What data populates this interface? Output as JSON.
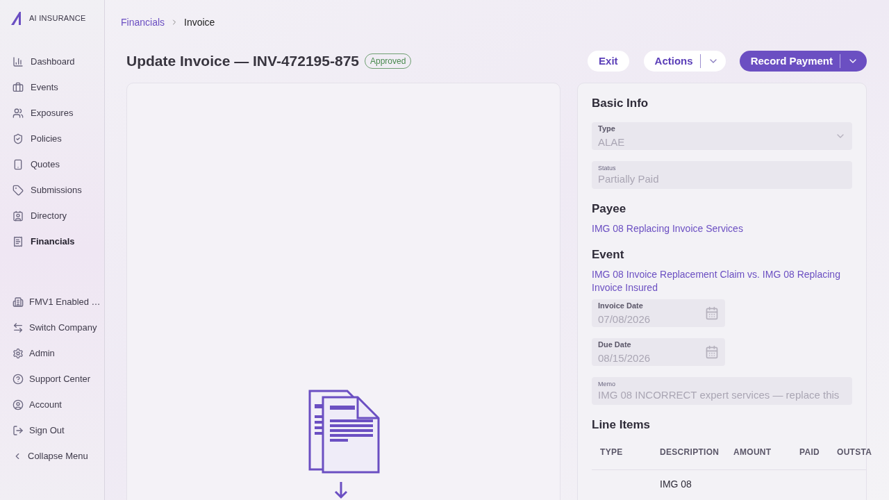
{
  "brand": {
    "name": "AI INSURANCE"
  },
  "nav": [
    {
      "label": "Dashboard",
      "selected": false
    },
    {
      "label": "Events",
      "selected": false
    },
    {
      "label": "Exposures",
      "selected": false
    },
    {
      "label": "Policies",
      "selected": false
    },
    {
      "label": "Quotes",
      "selected": false
    },
    {
      "label": "Submissions",
      "selected": false
    },
    {
      "label": "Directory",
      "selected": false
    },
    {
      "label": "Financials",
      "selected": true
    }
  ],
  "nav_bottom": [
    {
      "label": "FMV1 Enabled …"
    },
    {
      "label": "Switch Company"
    },
    {
      "label": "Admin"
    },
    {
      "label": "Support Center"
    },
    {
      "label": "Account"
    },
    {
      "label": "Sign Out"
    },
    {
      "label": "Collapse Menu"
    }
  ],
  "breadcrumb": [
    "Financials",
    "Invoice"
  ],
  "title": "Update Invoice — INV-472195-875",
  "status_badge": "Approved",
  "buttons": {
    "exit": "Exit",
    "actions": "Actions",
    "primary": "Record Payment"
  },
  "details": {
    "section_title": "Basic Info",
    "type": {
      "label": "Type",
      "value": "ALAE",
      "disabled": true
    },
    "status": {
      "label": "Status",
      "value": "Partially Paid",
      "disabled": true
    },
    "payee_title": "Payee",
    "payee": "IMG 08 Replacing Invoice Services",
    "event_title": "Event",
    "event": "IMG 08 Invoice Replacement Claim vs. IMG 08 Replacing Invoice Insured",
    "invoice_date": {
      "label": "Invoice Date",
      "value": "07/08/2026"
    },
    "due_date": {
      "label": "Due Date",
      "value": "08/15/2026"
    },
    "memo": {
      "label": "Memo",
      "value": "IMG 08 INCORRECT expert services — replace this"
    },
    "line_items_title": "Line Items",
    "columns": [
      "TYPE",
      "DESCRIPTION",
      "AMOUNT",
      "PAID",
      "OUTSTA"
    ],
    "rows": [
      {
        "description": "IMG 08"
      }
    ]
  }
}
